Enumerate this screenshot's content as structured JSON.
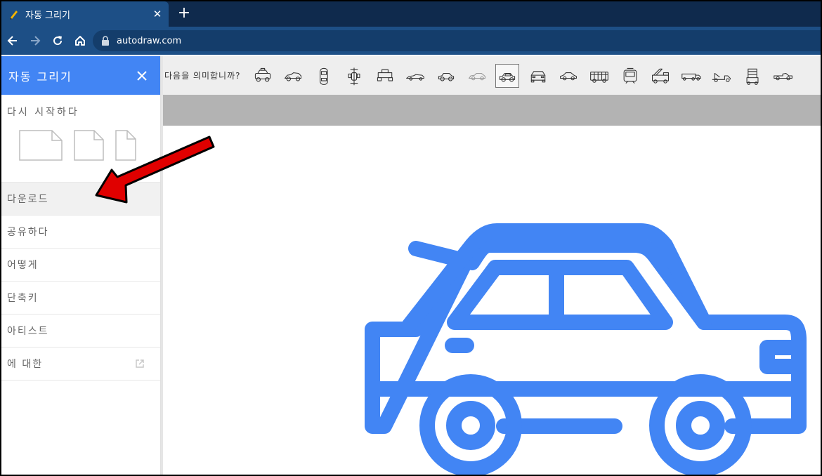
{
  "browser": {
    "tab_title": "자동 그리기",
    "tab_close": "✕",
    "new_tab": "+",
    "url": "autodraw.com"
  },
  "sidebar": {
    "title": "자동 그리기",
    "restart_label": "다시 시작하다",
    "items": [
      {
        "label": "다운로드"
      },
      {
        "label": "공유하다"
      },
      {
        "label": "어떻게"
      },
      {
        "label": "단축키"
      },
      {
        "label": "아티스트"
      },
      {
        "label": "에 대한"
      }
    ]
  },
  "suggestions": {
    "label": "다음을 의미합니까?",
    "items": [
      "police-car-icon",
      "race-car-icon",
      "car-top-view-icon",
      "formula-car-icon",
      "tractor-icon",
      "sports-car-icon",
      "compact-car-icon",
      "sedan-outline-icon",
      "sedan-selected-icon",
      "car-front-icon",
      "coupe-icon",
      "bus-icon",
      "tram-icon",
      "fire-truck-icon",
      "semi-truck-icon",
      "tow-truck-icon",
      "crane-icon",
      "pickup-icon"
    ],
    "selected_index": 8
  },
  "colors": {
    "accent": "#4285f4",
    "chrome_dark": "#0f2a4d",
    "chrome": "#1d4f86",
    "arrow": "#e00000"
  }
}
